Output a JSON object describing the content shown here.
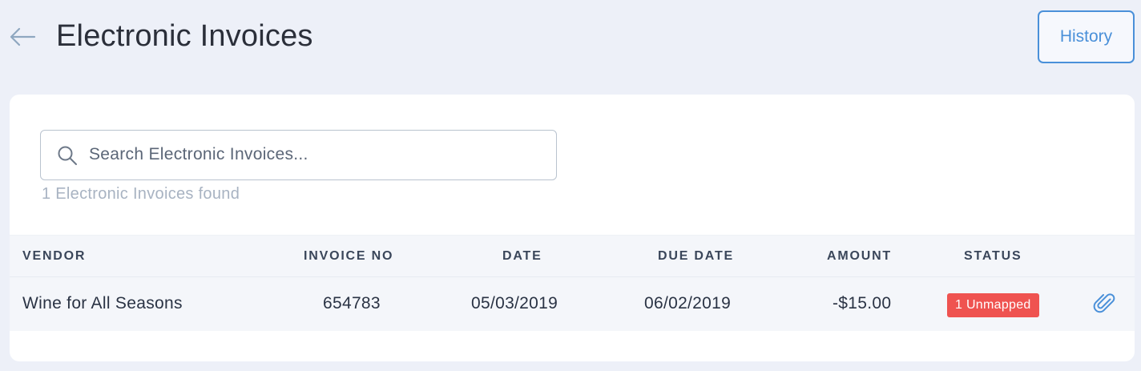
{
  "header": {
    "title": "Electronic Invoices",
    "history_label": "History"
  },
  "search": {
    "placeholder": "Search Electronic Invoices...",
    "value": "",
    "icon": "search-icon"
  },
  "results": {
    "count_text": "1 Electronic Invoices found"
  },
  "table": {
    "columns": [
      "VENDOR",
      "INVOICE NO",
      "DATE",
      "DUE DATE",
      "AMOUNT",
      "STATUS"
    ],
    "rows": [
      {
        "vendor": "Wine for All Seasons",
        "invoice_no": "654783",
        "date": "05/03/2019",
        "due_date": "06/02/2019",
        "amount": "-$15.00",
        "status": "1 Unmapped",
        "action_icon": "paperclip-icon"
      }
    ]
  },
  "colors": {
    "accent": "#4a90d9",
    "status_unmapped": "#ef5350",
    "page_background": "#edf0f8"
  }
}
